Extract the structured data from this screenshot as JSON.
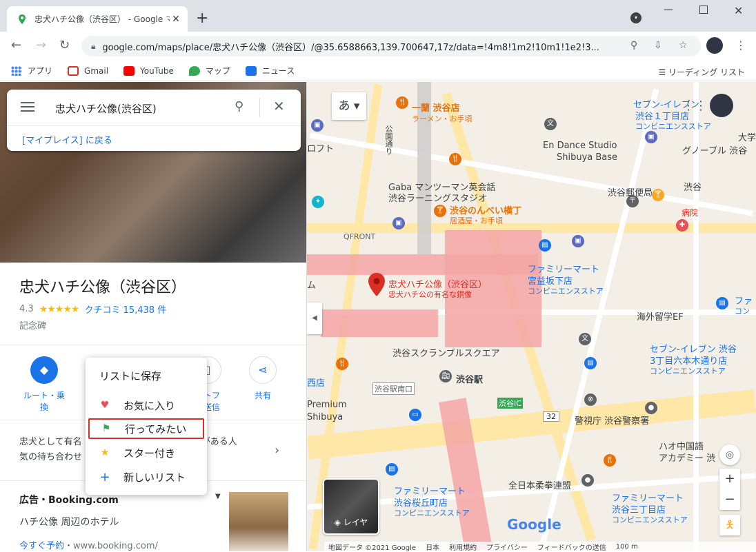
{
  "browser": {
    "tab_title": "忠犬ハチ公像（渋谷区） - Google マップ",
    "url": "google.com/maps/place/忠犬ハチ公像（渋谷区）/@35.6588663,139.700647,17z/data=!4m8!1m2!10m1!1e2!3...",
    "bookmarks": [
      {
        "label": "アプリ",
        "icon": "apps-grid-icon",
        "color": "#4285f4"
      },
      {
        "label": "Gmail",
        "icon": "gmail-icon",
        "color": "#d93025"
      },
      {
        "label": "YouTube",
        "icon": "youtube-icon",
        "color": "#ff0000"
      },
      {
        "label": "マップ",
        "icon": "maps-icon",
        "color": "#34a853"
      },
      {
        "label": "ニュース",
        "icon": "news-icon",
        "color": "#1a73e8"
      }
    ],
    "reading_list": "リーディング リスト"
  },
  "search": {
    "value": "忠犬ハチ公像(渋谷区)",
    "back_link": "[マイプレイス] に戻る"
  },
  "place": {
    "title": "忠犬ハチ公像（渋谷区）",
    "rating": "4.3",
    "stars": "★★★★★",
    "reviews": "クチコミ 15,438 件",
    "category": "記念碑",
    "description": "忠犬として有名で、多くの人と待ち合わせ場所として人気がある人気の待ち合わせ場所",
    "description_display": "忠犬として有名　　　　　　　　　　　　　 がある人\n気の待ち合わせ"
  },
  "actions": [
    {
      "label": "ルート・乗換",
      "icon": "directions-icon",
      "filled": true
    },
    {
      "label": "スマートフォンに送信",
      "label_display": "ートフ\nに送信",
      "icon": "send-phone-icon",
      "filled": false
    },
    {
      "label": "共有",
      "icon": "share-icon",
      "filled": false
    }
  ],
  "save_popup": {
    "title": "リストに保存",
    "items": [
      {
        "label": "お気に入り",
        "icon": "heart-icon",
        "color": "#e8505b"
      },
      {
        "label": "行ってみたい",
        "icon": "flag-icon",
        "color": "#34a853",
        "highlighted": true
      },
      {
        "label": "スター付き",
        "icon": "star-icon",
        "color": "#fbbc04"
      },
      {
        "label": "新しいリスト",
        "icon": "plus-icon",
        "color": "#1a73e8"
      }
    ]
  },
  "ad": {
    "title": "広告・Booking.com",
    "subtitle": "ハチ公像 周辺のホテル",
    "link_label": "今すぐ予約",
    "link_url": "・www.booking.com/"
  },
  "map": {
    "lang_button": "あ",
    "layer_button": "レイヤ",
    "marker_title": "忠犬ハチ公像（渋谷区）",
    "marker_sub": "忠犬ハチ公の有名な銅像",
    "labels": {
      "ichiran": "一蘭 渋谷店",
      "ichiran_sub": "ラーメン・お手頃",
      "seven1": "セブン-イレブン",
      "seven1_b": "渋谷１丁目店",
      "seven1_c": "コンビニエンスストア",
      "endance": "En Dance Studio",
      "endance_b": "Shibuya Base",
      "gnoble": "グノーブル 渋谷",
      "gaba": "Gaba マンツーマン英会話",
      "gaba_b": "渋谷ラーニングスタジオ",
      "post": "渋谷郵便局",
      "shibuya": "渋谷",
      "nonbei": "渋谷のんべい横丁",
      "nonbei_b": "居酒屋・お手頃",
      "hospital": "病院",
      "qfront": "QFRONT",
      "family1": "ファミリーマート",
      "family1_b": "宮益坂下店",
      "family1_c": "コンビニエンスストア",
      "kaigai": "海外留学EF",
      "scramble": "渋谷スクランブルスクエア",
      "station": "渋谷駅",
      "seven2": "セブン-イレブン 渋谷",
      "seven2_b": "3丁目六本木通り店",
      "seven2_c": "コンビニエンスストア",
      "south_exit": "渋谷駅南口",
      "ic": "渋谷IC",
      "route": "32",
      "premium": "Premium",
      "premium_b": "Shibuya",
      "police": "警視庁 渋谷警察署",
      "haoh": "ハオ中国語",
      "haoh_b": "アカデミー 渋",
      "judo": "全日本柔拳連盟",
      "family2": "ファミリーマート",
      "family2_b": "渋谷桜丘町店",
      "family2_c": "コンビニエンスストア",
      "family3": "ファミリーマート",
      "family3_b": "渋谷三丁目店",
      "family3_c": "コンビニエンスストア",
      "koen": "公園通り",
      "loft": "ロフト",
      "daigaku": "大学",
      "fa": "ファ",
      "kon": "コン",
      "nishi": "西店",
      "ten": "ム"
    },
    "footer": [
      "地図データ ©2021 Google",
      "日本",
      "利用規約",
      "プライバシー",
      "フィードバックの送信",
      "100 m"
    ],
    "google_logo": "Google"
  }
}
